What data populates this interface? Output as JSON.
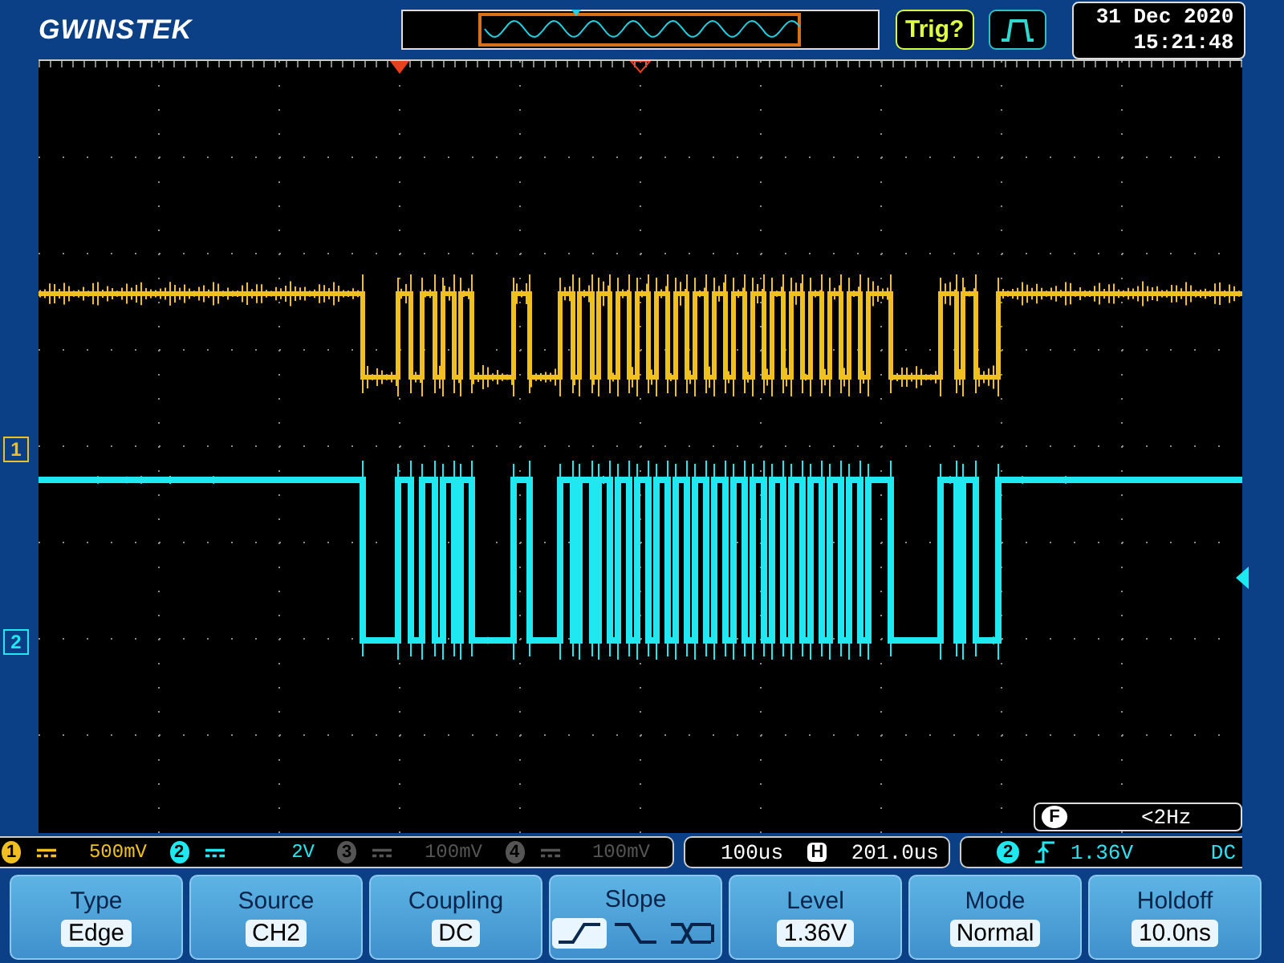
{
  "header": {
    "logo": "GWINSTEK",
    "trigger_status": "Trig?",
    "date": "31 Dec 2020",
    "time": "15:21:48"
  },
  "channels": [
    {
      "number": "1",
      "marker": "1",
      "scale": "500mV",
      "on": true,
      "color": "#f0c020"
    },
    {
      "number": "2",
      "marker": "2",
      "scale": "2V",
      "on": true,
      "color": "#20e8f0"
    },
    {
      "number": "3",
      "scale": "100mV",
      "on": false
    },
    {
      "number": "4",
      "scale": "100mV",
      "on": false
    }
  ],
  "frequency": {
    "label": "F",
    "value": "<2Hz"
  },
  "timebase": {
    "scale": "100us",
    "position_label": "H",
    "position": "201.0us"
  },
  "trigger": {
    "source": "2",
    "rising_edge": true,
    "level": "1.36V",
    "coupling": "DC"
  },
  "menu": [
    {
      "kind": "value",
      "label": "Type",
      "value": "Edge"
    },
    {
      "kind": "value",
      "label": "Source",
      "value": "CH2"
    },
    {
      "kind": "value",
      "label": "Coupling",
      "value": "DC"
    },
    {
      "kind": "options",
      "label": "Slope",
      "options": [
        {
          "kind": "rising",
          "selected": true
        },
        {
          "kind": "falling",
          "selected": false
        },
        {
          "kind": "either",
          "selected": false
        }
      ]
    },
    {
      "kind": "value",
      "label": "Level",
      "value": "1.36V"
    },
    {
      "kind": "value",
      "label": "Mode",
      "value": "Normal"
    },
    {
      "kind": "value",
      "label": "Holdoff",
      "value": "10.0ns"
    }
  ]
}
